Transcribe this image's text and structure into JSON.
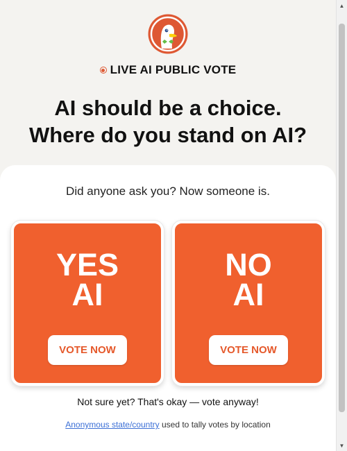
{
  "header": {
    "logo_icon": "duckduckgo-logo-icon",
    "live_label": "LIVE AI PUBLIC VOTE",
    "headline_line1": "AI should be a choice.",
    "headline_line2": "Where do you stand on AI?"
  },
  "card": {
    "question": "Did anyone ask you? Now someone is.",
    "options": [
      {
        "line1": "YES",
        "line2": "AI",
        "button": "VOTE NOW"
      },
      {
        "line1": "NO",
        "line2": "AI",
        "button": "VOTE NOW"
      }
    ],
    "not_sure": "Not sure yet? That's okay — vote anyway!",
    "footnote_link": "Anonymous state/country",
    "footnote_rest": " used to tally votes by location"
  },
  "colors": {
    "accent": "#f0602e",
    "background": "#f4f3f0",
    "link": "#3b6fd6"
  }
}
